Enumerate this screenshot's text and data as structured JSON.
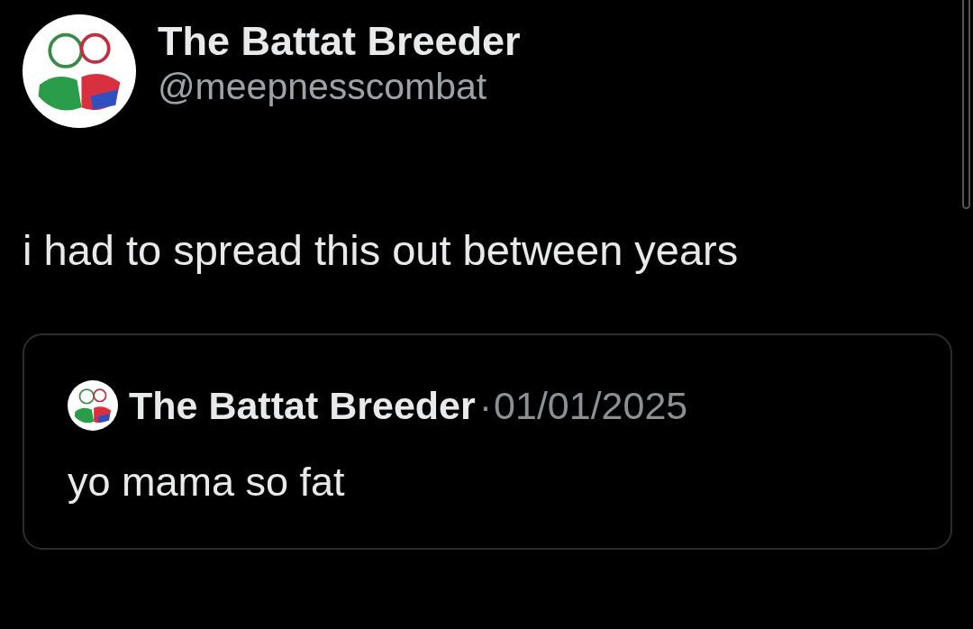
{
  "tweet": {
    "author": {
      "name": "The Battat Breeder",
      "handle": "@meepnesscombat"
    },
    "text": "i had to spread this out between years",
    "quoted_tweet": {
      "author_name": "The Battat Breeder",
      "separator": "·",
      "date": "01/01/2025",
      "text": "yo mama so fat"
    }
  }
}
